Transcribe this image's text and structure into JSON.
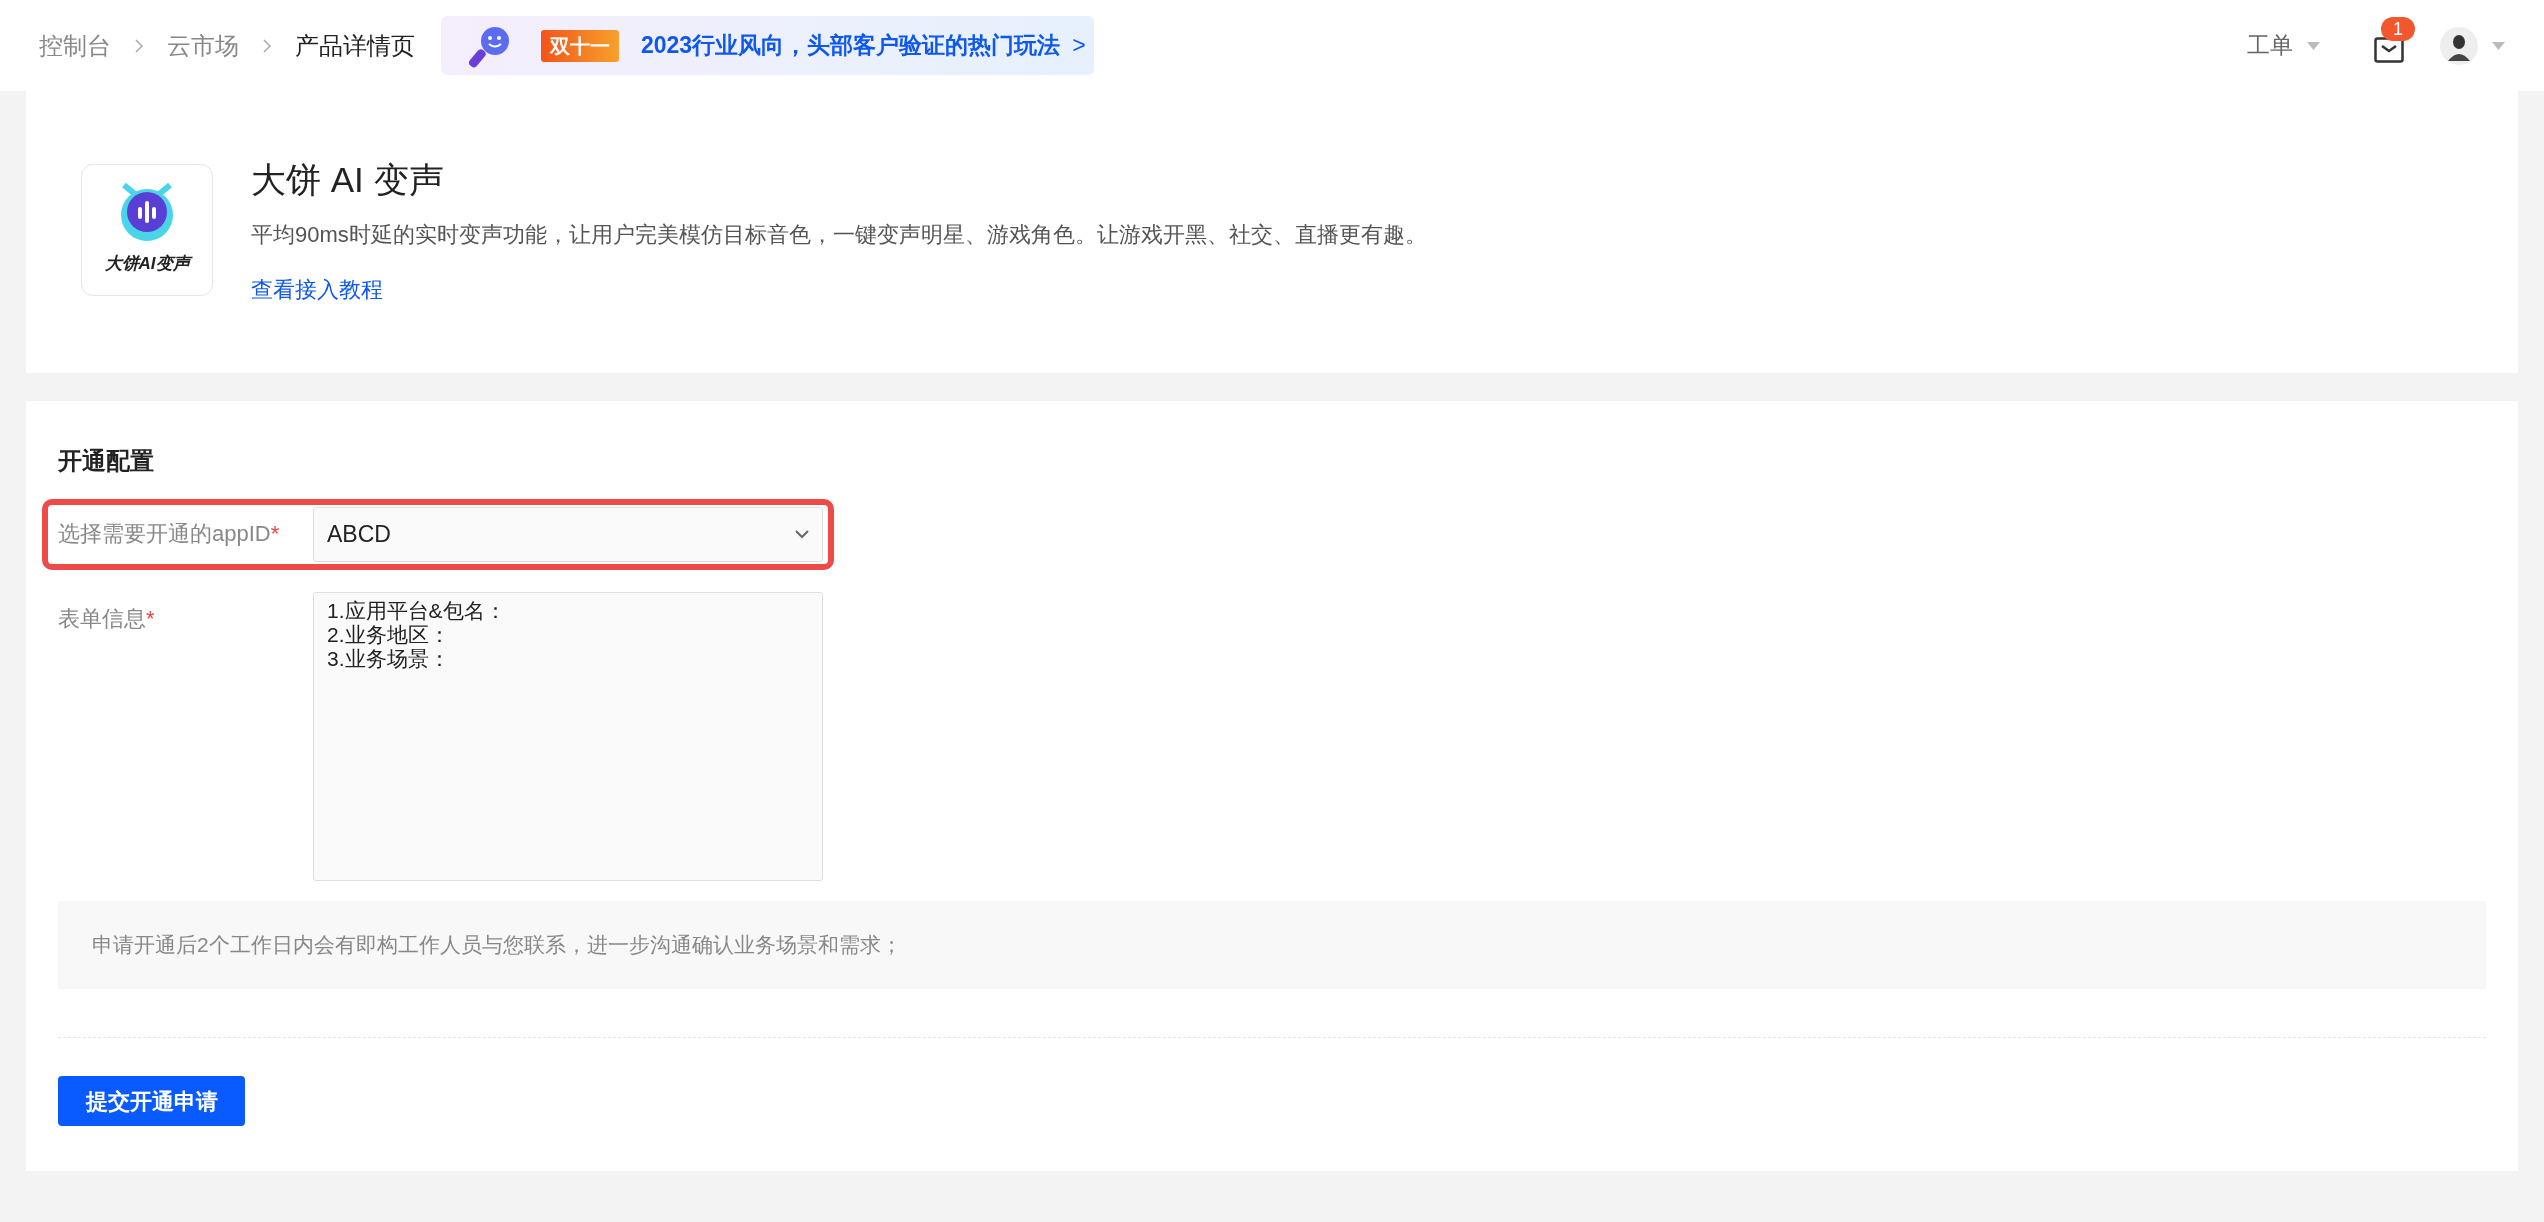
{
  "breadcrumb": [
    {
      "label": "控制台",
      "current": false
    },
    {
      "label": "云市场",
      "current": false
    },
    {
      "label": "产品详情页",
      "current": true
    }
  ],
  "promo_banner": {
    "tag": "双十一",
    "text": "2023行业风向，头部客户验证的热门玩法",
    "arrow": ">"
  },
  "header_right": {
    "work_order": "工单",
    "notifications": "1"
  },
  "product": {
    "logo_text": "大饼AI变声",
    "title": "大饼 AI 变声",
    "description": "平均90ms时延的实时变声功能，让用户完美模仿目标音色，一键变声明星、游戏角色。让游戏开黑、社交、直播更有趣。",
    "tutorial_link": "查看接入教程"
  },
  "config": {
    "heading": "开通配置",
    "fields": [
      {
        "kind": "select",
        "label": "选择需要开通的appID",
        "required_mark": "*",
        "highlighted": true,
        "value": "ABCD"
      },
      {
        "kind": "textarea",
        "label": "表单信息",
        "required_mark": "*",
        "highlighted": false,
        "value": "1.应用平台&包名：\n2.业务地区：\n3.业务场景："
      }
    ],
    "notice": "申请开通后2个工作日内会有即构工作人员与您联系，进一步沟通确认业务场景和需求；",
    "submit_button": "提交开通申请"
  }
}
